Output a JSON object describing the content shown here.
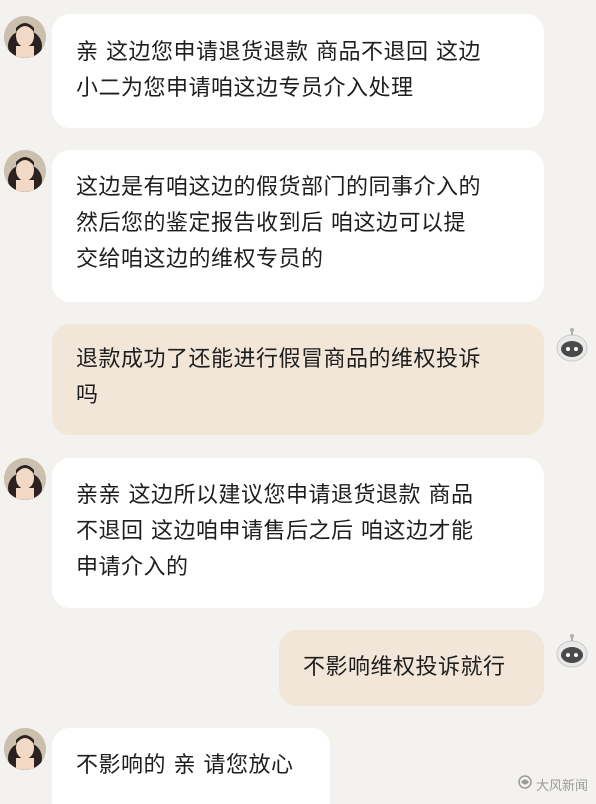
{
  "messages": [
    {
      "id": "m1",
      "side": "left",
      "text": "亲 这边您申请退货退款 商品不退回  这边\n小二为您申请咱这边专员介入处理"
    },
    {
      "id": "m2",
      "side": "left",
      "text": "这边是有咱这边的假货部门的同事介入的\n然后您的鉴定报告收到后 咱这边可以提\n交给咱这边的维权专员的"
    },
    {
      "id": "m3",
      "side": "right",
      "text": "退款成功了还能进行假冒商品的维权投诉\n吗"
    },
    {
      "id": "m4",
      "side": "left",
      "text": "亲亲 这边所以建议您申请退货退款 商品\n不退回 这边咱申请售后之后 咱这边才能\n申请介入的"
    },
    {
      "id": "m5",
      "side": "right",
      "text": "不影响维权投诉就行"
    },
    {
      "id": "m6",
      "side": "left",
      "text": "不影响的 亲 请您放心"
    }
  ],
  "watermark": {
    "text": "大风新闻",
    "icon": "fengniao-logo-icon"
  },
  "colors": {
    "background": "#f3f2ef",
    "left_bubble": "#ffffff",
    "right_bubble": "#f1e6d8",
    "text": "#1e1e1e"
  }
}
